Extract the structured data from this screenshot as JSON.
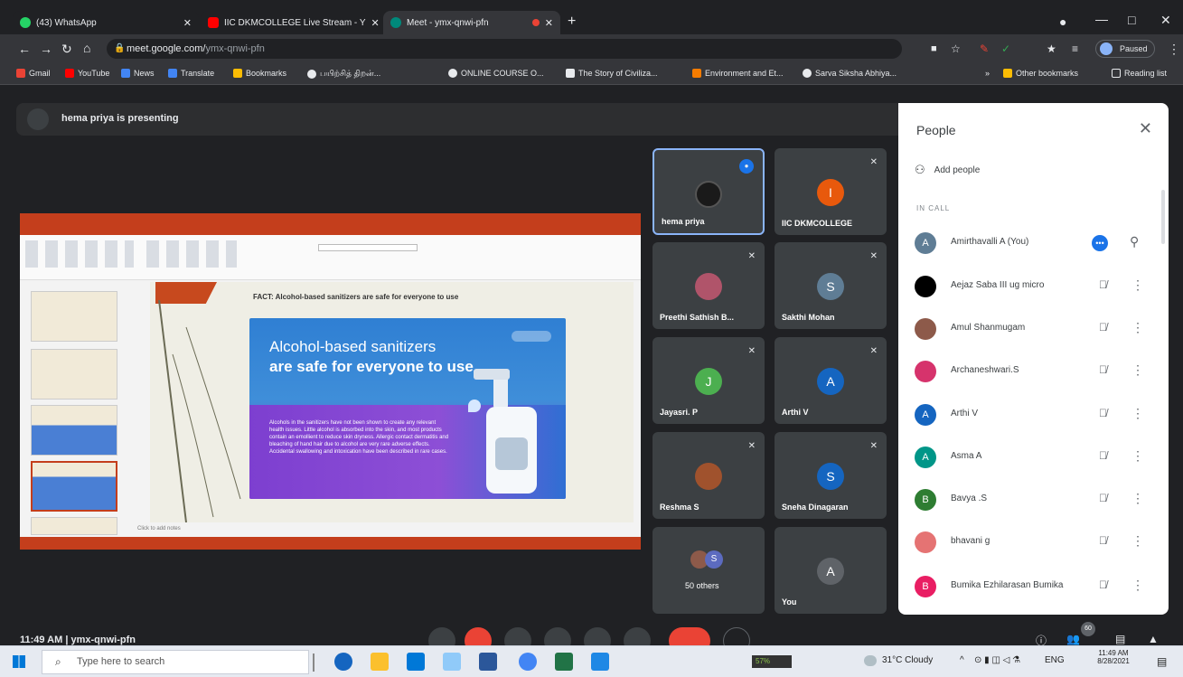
{
  "browser": {
    "tabs": [
      {
        "label": "(43) WhatsApp",
        "color": "#25d366"
      },
      {
        "label": "IIC DKMCOLLEGE Live Stream - Y",
        "color": "#ff0000"
      },
      {
        "label": "Meet - ymx-qnwi-pfn",
        "color": "#00897b"
      }
    ],
    "url_host": "meet.google.com/",
    "url_path": "ymx-qnwi-pfn",
    "profile_label": "Paused",
    "bookmarks": [
      "Gmail",
      "YouTube",
      "News",
      "Translate",
      "Bookmarks",
      "பயிற்சித் திறன்...",
      "ONLINE COURSE O...",
      "The Story of Civiliza...",
      "Environment and Et...",
      "Sarva Siksha Abhiya..."
    ],
    "bookmarks_right": [
      "Other bookmarks",
      "Reading list"
    ]
  },
  "meet": {
    "presenting_label": "hema priya is presenting",
    "slide": {
      "fact_caption": "FACT: Alcohol-based sanitizers are safe for everyone to use",
      "title_line1": "Alcohol-based sanitizers",
      "title_line2": "are safe for everyone to use",
      "body": "Alcohols in the sanitizers have not been shown to create any relevant health issues. Little alcohol is absorbed into the skin, and most products contain an emollient to reduce skin dryness. Allergic contact dermatitis and bleaching of hand hair due to alcohol are very rare adverse effects. Accidental swallowing and intoxication have been described in rare cases.",
      "notes_placeholder": "Click to add notes"
    },
    "tiles": [
      {
        "name": "hema priya",
        "initial": "",
        "color": "#1a1a1a",
        "mic": "●"
      },
      {
        "name": "IIC DKMCOLLEGE",
        "initial": "I",
        "color": "#e8590c",
        "mic": "✕"
      },
      {
        "name": "Preethi Sathish B...",
        "initial": "",
        "color": "#b0546a",
        "mic": "✕"
      },
      {
        "name": "Sakthi Mohan",
        "initial": "S",
        "color": "#5f7d95",
        "mic": "✕"
      },
      {
        "name": "Jayasri. P",
        "initial": "J",
        "color": "#4caf50",
        "mic": "✕"
      },
      {
        "name": "Arthi V",
        "initial": "A",
        "color": "#1565c0",
        "mic": "✕"
      },
      {
        "name": "Reshma S",
        "initial": "",
        "color": "#a0522d",
        "mic": "✕"
      },
      {
        "name": "Sneha Dinagaran",
        "initial": "S",
        "color": "#1565c0",
        "mic": "✕"
      },
      {
        "name": "50 others",
        "initial": "S",
        "color": "#5c6bc0",
        "mic": ""
      },
      {
        "name": "You",
        "initial": "A",
        "color": "#5f6368",
        "mic": ""
      }
    ],
    "meeting_code": "11:49 AM | ymx-qnwi-pfn",
    "participant_badge": "60"
  },
  "people": {
    "title": "People",
    "add_label": "Add people",
    "section_label": "IN CALL",
    "list": [
      {
        "name": "Amirthavalli A (You)",
        "initial": "A",
        "color": "#5f7d95"
      },
      {
        "name": "Aejaz Saba III ug micro",
        "initial": "",
        "color": "#000000"
      },
      {
        "name": "Amul Shanmugam",
        "initial": "",
        "color": "#8d5a4a"
      },
      {
        "name": "Archaneshwari.S",
        "initial": "",
        "color": "#d6336c"
      },
      {
        "name": "Arthi V",
        "initial": "A",
        "color": "#1565c0"
      },
      {
        "name": "Asma A",
        "initial": "A",
        "color": "#009688"
      },
      {
        "name": "Bavya .S",
        "initial": "B",
        "color": "#2e7d32"
      },
      {
        "name": "bhavani g",
        "initial": "",
        "color": "#e57373"
      },
      {
        "name": "Bumika Ezhilarasan Bumika",
        "initial": "B",
        "color": "#e91e63"
      }
    ]
  },
  "taskbar": {
    "search_placeholder": "Type here to search",
    "weather": "31°C Cloudy",
    "lang": "ENG",
    "time": "11:49 AM",
    "date": "8/28/2021",
    "battery_label": "57%"
  }
}
